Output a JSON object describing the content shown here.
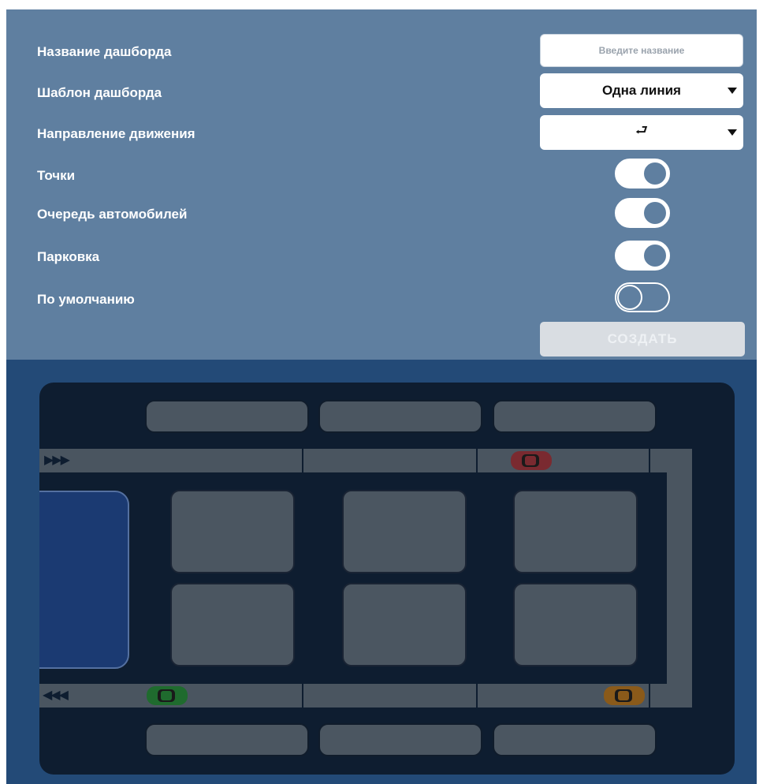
{
  "form": {
    "fields": [
      {
        "label": "Название дашборда"
      },
      {
        "label": "Шаблон дашборда"
      },
      {
        "label": "Направление движения"
      },
      {
        "label": "Точки"
      },
      {
        "label": "Очередь автомобилей"
      },
      {
        "label": "Парковка"
      },
      {
        "label": "По умолчанию"
      }
    ],
    "name_input": {
      "value": "",
      "placeholder": "Введите название"
    },
    "template_select": {
      "selected": "Одна линия"
    },
    "direction_select": {
      "selected": "⮐"
    },
    "toggles": {
      "points": true,
      "car_queue": true,
      "parking": true,
      "default": false
    },
    "create_button": "СОЗДАТЬ"
  },
  "scene": {
    "top_lane_arrows": "▶▶▶",
    "bottom_lane_arrows": "◀◀◀",
    "cars": [
      {
        "name": "red-car",
        "color": "#7a2a30"
      },
      {
        "name": "green-car",
        "color": "#1f6b2e"
      },
      {
        "name": "orange-car",
        "color": "#8a5a1a"
      }
    ]
  },
  "colors": {
    "form_bg": "#5f7fa0",
    "scene_bg": "#234a77",
    "map_bg": "#0e1d30",
    "road": "#4a5560",
    "lot": "#1b3a72",
    "button_disabled": "#d9dde2"
  }
}
